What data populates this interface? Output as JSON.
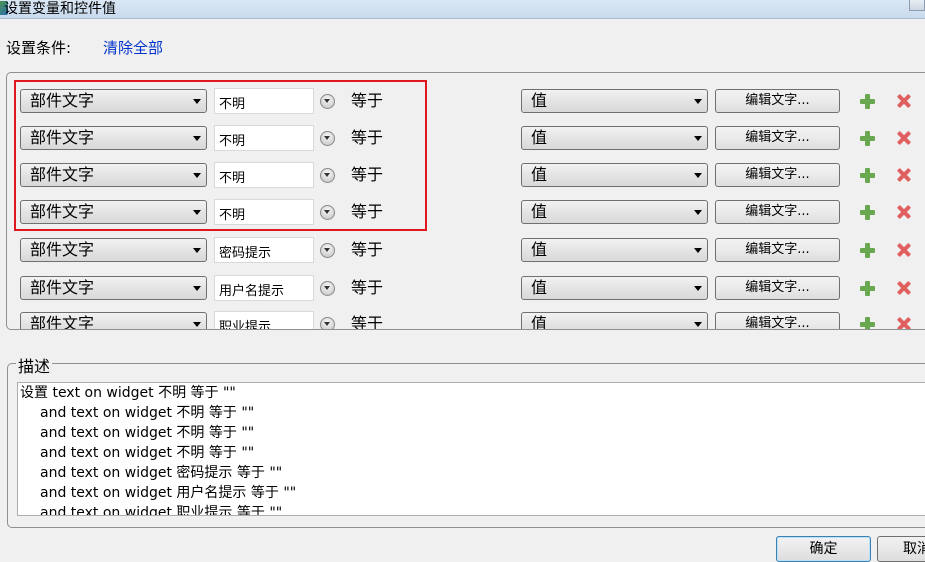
{
  "window": {
    "title": "设置变量和控件值"
  },
  "conditions": {
    "label": "设置条件:",
    "clear_all": "清除全部",
    "rows": [
      {
        "source": "部件文字",
        "widget": "不明",
        "operator": "等于",
        "value_type": "值",
        "edit_label": "编辑文字..."
      },
      {
        "source": "部件文字",
        "widget": "不明",
        "operator": "等于",
        "value_type": "值",
        "edit_label": "编辑文字..."
      },
      {
        "source": "部件文字",
        "widget": "不明",
        "operator": "等于",
        "value_type": "值",
        "edit_label": "编辑文字..."
      },
      {
        "source": "部件文字",
        "widget": "不明",
        "operator": "等于",
        "value_type": "值",
        "edit_label": "编辑文字..."
      },
      {
        "source": "部件文字",
        "widget": "密码提示",
        "operator": "等于",
        "value_type": "值",
        "edit_label": "编辑文字..."
      },
      {
        "source": "部件文字",
        "widget": "用户名提示",
        "operator": "等于",
        "value_type": "值",
        "edit_label": "编辑文字..."
      },
      {
        "source": "部件文字",
        "widget": "职业提示",
        "operator": "等于",
        "value_type": "值",
        "edit_label": "编辑文字..."
      }
    ]
  },
  "description": {
    "legend": "描述",
    "lines": [
      "设置 text on widget 不明 等于 \"\"",
      "and text on widget 不明 等于 \"\"",
      "and text on widget 不明 等于 \"\"",
      "and text on widget 不明 等于 \"\"",
      "and text on widget 密码提示 等于 \"\"",
      "and text on widget 用户名提示 等于 \"\"",
      "and text on widget 职业提示 等于 \"\""
    ]
  },
  "footer": {
    "ok": "确定",
    "cancel": "取消"
  },
  "colors": {
    "highlight": "#e0161d",
    "link": "#0033cc",
    "add_icon": "#6aa84f",
    "delete_icon": "#e06060"
  }
}
